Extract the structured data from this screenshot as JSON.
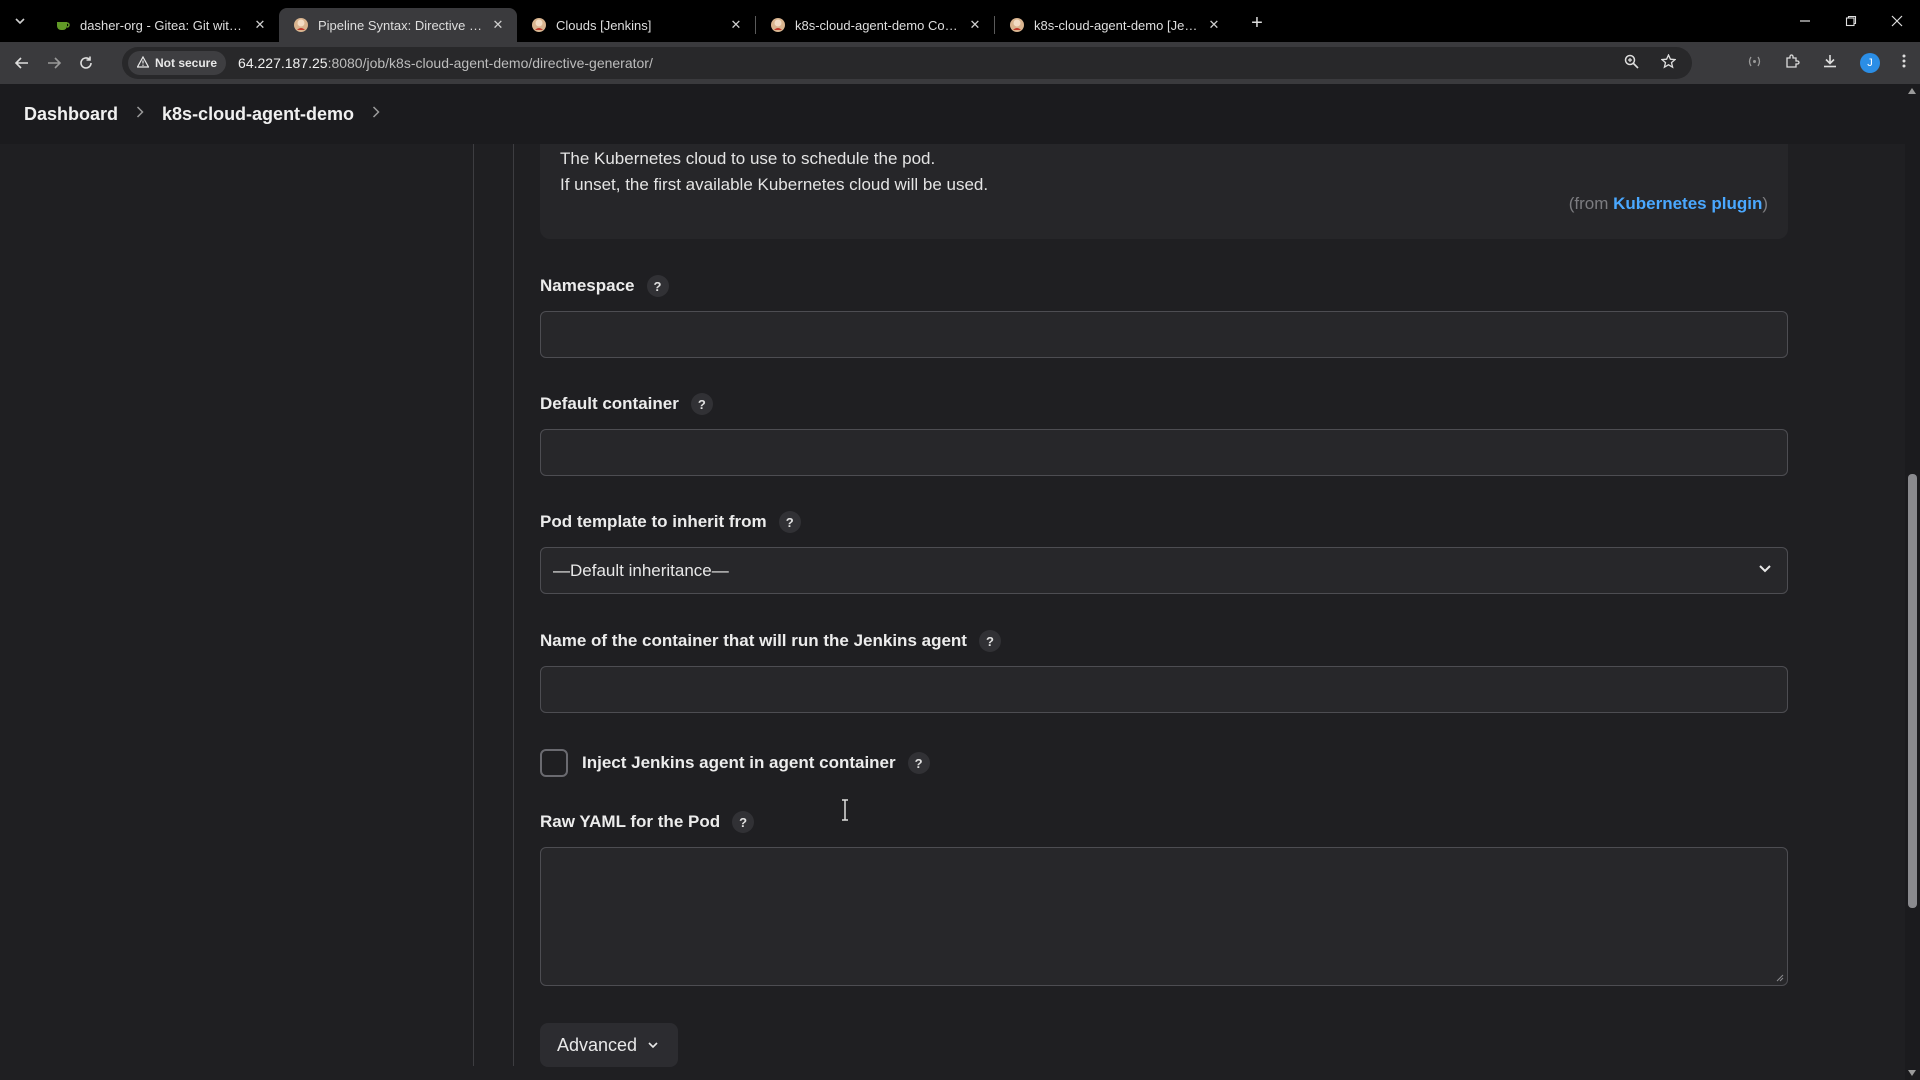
{
  "browser": {
    "tabs": [
      {
        "title": "dasher-org - Gitea: Git with a cup of tea",
        "favicon": "gitea-icon",
        "active": false
      },
      {
        "title": "Pipeline Syntax: Directive Generator",
        "favicon": "jenkins-icon",
        "active": true
      },
      {
        "title": "Clouds [Jenkins]",
        "favicon": "jenkins-icon",
        "active": false
      },
      {
        "title": "k8s-cloud-agent-demo Config [Jenkins]",
        "favicon": "jenkins-icon",
        "active": false
      },
      {
        "title": "k8s-cloud-agent-demo [Jenkins]",
        "favicon": "jenkins-icon",
        "active": false
      }
    ],
    "security_label": "Not secure",
    "url_host": "64.227.187.25",
    "url_rest": ":8080/job/k8s-cloud-agent-demo/directive-generator/",
    "profile_initial": "J"
  },
  "breadcrumbs": [
    "Dashboard",
    "k8s-cloud-agent-demo"
  ],
  "help": {
    "line1": "The Kubernetes cloud to use to schedule the pod.",
    "line2": "If unset, the first available Kubernetes cloud will be used.",
    "from_prefix": "(from ",
    "plugin": "Kubernetes plugin",
    "from_suffix": ")"
  },
  "fields": {
    "namespace": {
      "label": "Namespace",
      "value": ""
    },
    "default_container": {
      "label": "Default container",
      "value": ""
    },
    "inherit": {
      "label": "Pod template to inherit from",
      "selected": "—Default inheritance—"
    },
    "agent_container": {
      "label": "Name of the container that will run the Jenkins agent",
      "value": ""
    },
    "inject": {
      "label": "Inject Jenkins agent in agent container",
      "checked": false
    },
    "raw_yaml": {
      "label": "Raw YAML for the Pod",
      "value": ""
    }
  },
  "help_mark": "?",
  "advanced_label": "Advanced",
  "colors": {
    "accent": "#4aa8ff",
    "background": "#1f1f22"
  }
}
